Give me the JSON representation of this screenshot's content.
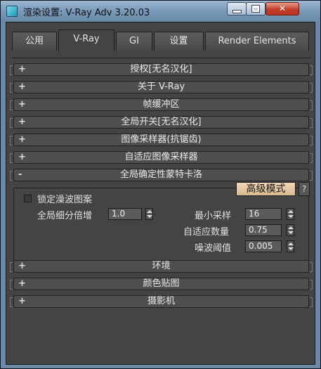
{
  "window": {
    "title": "渲染设置: V-Ray Adv 3.20.03",
    "min_label": "",
    "max_label": "",
    "close_label": "✕"
  },
  "tabs": [
    {
      "label": "公用"
    },
    {
      "label": "V-Ray"
    },
    {
      "label": "GI"
    },
    {
      "label": "设置"
    },
    {
      "label": "Render Elements"
    }
  ],
  "rollouts_top": [
    {
      "sign": "+",
      "label": "授权[无名汉化]"
    },
    {
      "sign": "+",
      "label": "关于 V-Ray"
    },
    {
      "sign": "+",
      "label": "帧缓冲区"
    },
    {
      "sign": "+",
      "label": "全局开关[无名汉化]"
    },
    {
      "sign": "+",
      "label": "图像采样器(抗锯齿)"
    },
    {
      "sign": "+",
      "label": "自适应图像采样器"
    }
  ],
  "open_rollout": {
    "sign": "-",
    "label": "全局确定性蒙特卡洛",
    "lock_noise_label": "锁定澡波图案",
    "lock_noise_checked": false,
    "subdiv_mult_label": "全局细分倍增",
    "subdiv_mult_value": "1.0",
    "advanced_button": "高级模式",
    "help_button": "?",
    "min_samples_label": "最小采样",
    "min_samples_value": "16",
    "adaptive_amount_label": "自适应数量",
    "adaptive_amount_value": "0.75",
    "noise_threshold_label": "噪波阈值",
    "noise_threshold_value": "0.005"
  },
  "rollouts_bottom": [
    {
      "sign": "+",
      "label": "环境"
    },
    {
      "sign": "+",
      "label": "颜色贴图"
    },
    {
      "sign": "+",
      "label": "摄影机"
    }
  ]
}
